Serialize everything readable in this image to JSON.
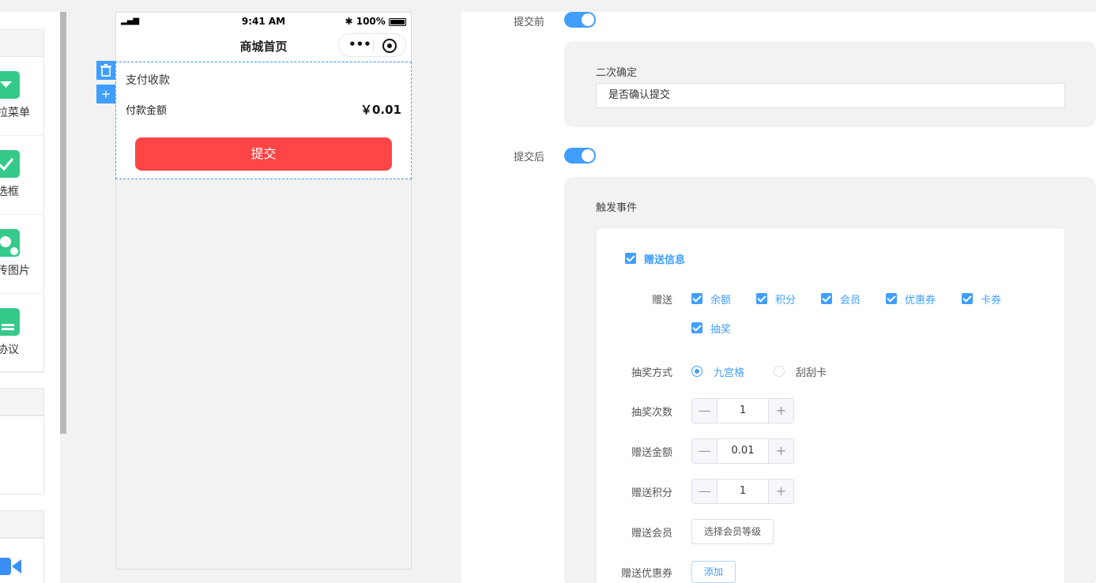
{
  "palette": {
    "items": [
      {
        "label": "拉菜单",
        "icon": "dropdown-icon"
      },
      {
        "label": "选框",
        "icon": "checkbox-icon"
      },
      {
        "label": "传图片",
        "icon": "image-upload-icon"
      },
      {
        "label": "协议",
        "icon": "agreement-icon"
      }
    ]
  },
  "phone": {
    "status_time": "9:41 AM",
    "status_signal": "▂▄▆",
    "status_battery": "100%",
    "nav_title": "商城首页",
    "nav_dots": "•••",
    "component": {
      "title": "支付收款",
      "amount_label": "付款金额",
      "amount_value": "￥0.01",
      "submit_label": "提交"
    },
    "tools": {
      "delete": "🗑",
      "add": "+"
    }
  },
  "config": {
    "before_label": "提交前",
    "before_enabled": true,
    "confirm_caption": "二次确定",
    "confirm_value": "是否确认提交",
    "after_label": "提交后",
    "after_enabled": true,
    "trigger_caption": "触发事件",
    "gift_info_label": "赠送信息",
    "gift_label": "赠送",
    "gift_options": [
      "余额",
      "积分",
      "会员",
      "优惠券",
      "卡券",
      "抽奖"
    ],
    "lottery_mode_label": "抽奖方式",
    "lottery_modes": [
      {
        "label": "九宫格",
        "selected": true
      },
      {
        "label": "刮刮卡",
        "selected": false
      }
    ],
    "lottery_times_label": "抽奖次数",
    "lottery_times": "1",
    "gift_amount_label": "赠送金额",
    "gift_amount": "0.01",
    "gift_points_label": "赠送积分",
    "gift_points": "1",
    "gift_member_label": "赠送会员",
    "gift_member_button": "选择会员等级",
    "gift_coupon_label": "赠送优惠券",
    "gift_coupon_button": "添加",
    "stepper_minus": "—",
    "stepper_plus": "+"
  },
  "colors": {
    "accent": "#409eff",
    "submit": "#ff4545",
    "palette_icon": "#35c98a"
  }
}
